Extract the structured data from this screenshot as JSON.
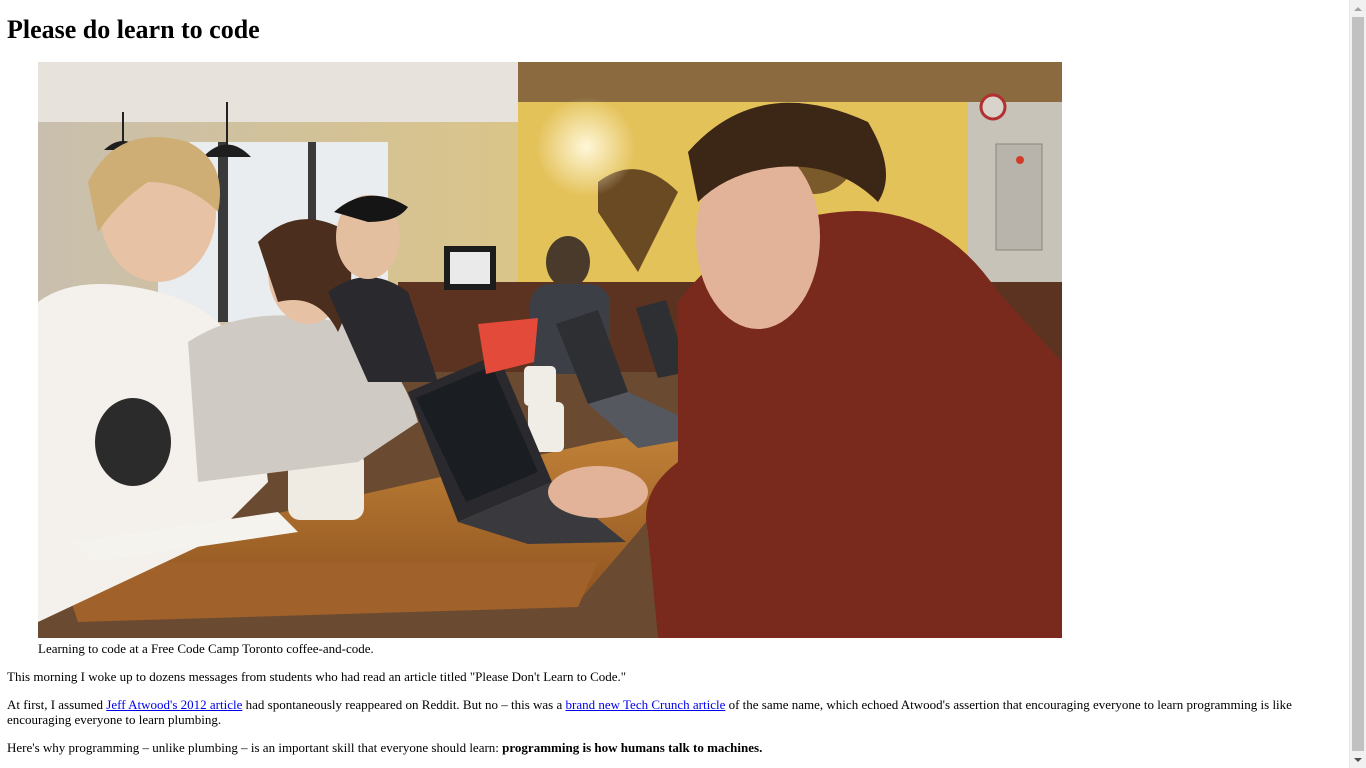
{
  "article": {
    "title": "Please do learn to code",
    "figure": {
      "alt": "Learning to code at a Free Code Camp Toronto coffee-and-code.",
      "caption": "Learning to code at a Free Code Camp Toronto coffee-and-code."
    },
    "paragraph1": "This morning I woke up to dozens messages from students who had read an article titled \"Please Don't Learn to Code.\"",
    "paragraph2": {
      "part1": "At first, I assumed ",
      "link1": "Jeff Atwood's 2012 article",
      "part2": " had spontaneously reappeared on Reddit. But no – this was a ",
      "link2": "brand new Tech Crunch article",
      "part3": " of the same name, which echoed Atwood's assertion that encouraging everyone to learn programming is like encouraging everyone to learn plumbing."
    },
    "paragraph3": {
      "part1": "Here's why programming – unlike plumbing – is an important skill that everyone should learn: ",
      "bold": "programming is how humans talk to machines."
    }
  },
  "colors": {
    "link": "#0000ee",
    "text": "#000000",
    "background": "#ffffff"
  },
  "scrollbar": {
    "up_icon": "scroll-up-arrow-icon",
    "down_icon": "scroll-down-arrow-icon"
  }
}
